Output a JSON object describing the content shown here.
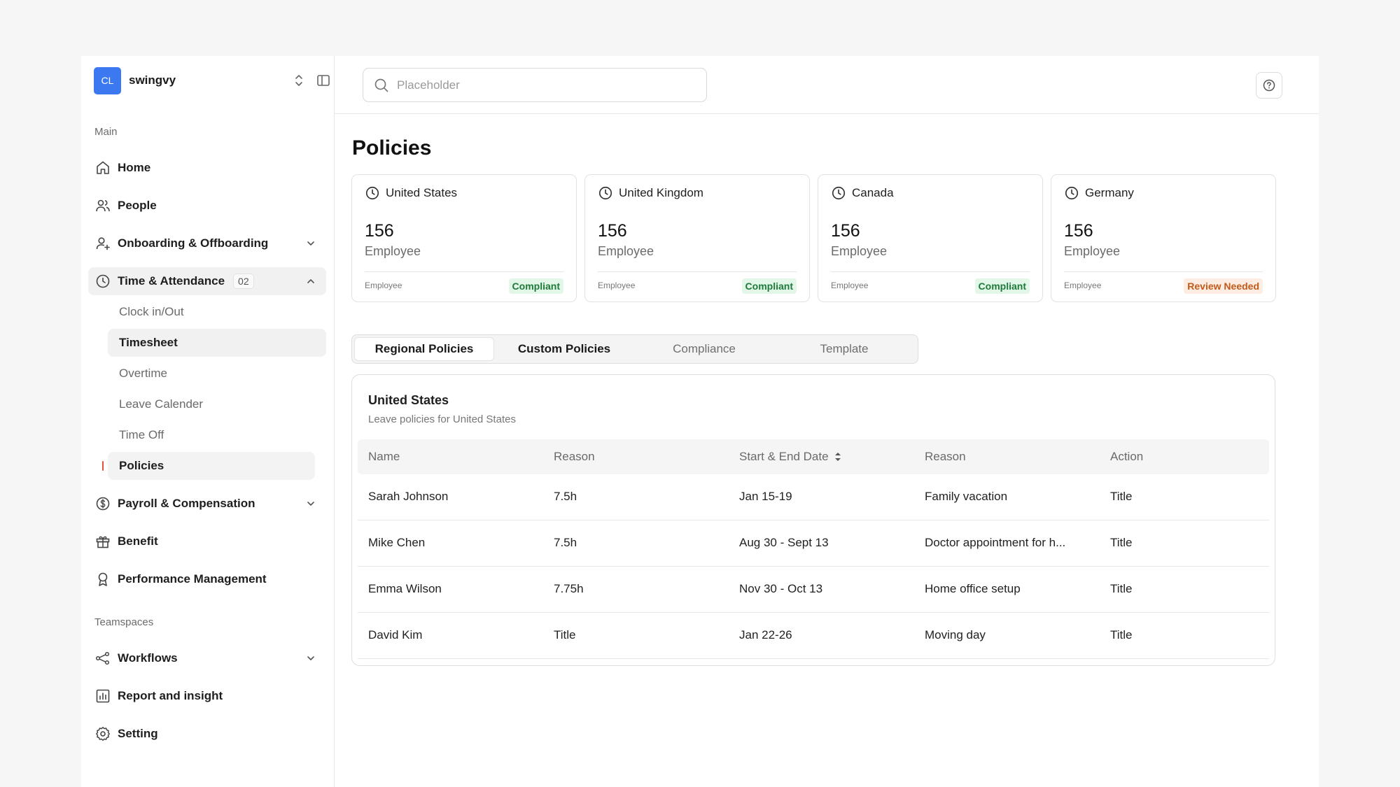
{
  "workspace": {
    "initials": "CL",
    "name": "swingvy"
  },
  "sidebar": {
    "main_label": "Main",
    "teamspaces_label": "Teamspaces",
    "items": [
      {
        "label": "Home",
        "icon": "home-icon"
      },
      {
        "label": "People",
        "icon": "people-icon"
      },
      {
        "label": "Onboarding & Offboarding",
        "icon": "user-plus-icon"
      },
      {
        "label": "Time & Attendance",
        "icon": "clock-icon",
        "badge": "02"
      },
      {
        "label": "Payroll & Compensation",
        "icon": "dollar-icon"
      },
      {
        "label": "Benefit",
        "icon": "gift-icon"
      },
      {
        "label": "Performance Management",
        "icon": "award-icon"
      }
    ],
    "sub_items": [
      {
        "label": "Clock in/Out"
      },
      {
        "label": "Timesheet"
      },
      {
        "label": "Overtime"
      },
      {
        "label": "Leave Calender"
      },
      {
        "label": "Time Off"
      },
      {
        "label": "Policies"
      }
    ],
    "team_items": [
      {
        "label": "Workflows",
        "icon": "workflow-icon"
      },
      {
        "label": "Report and insight",
        "icon": "chart-icon"
      },
      {
        "label": "Setting",
        "icon": "gear-icon"
      }
    ]
  },
  "search": {
    "placeholder": "Placeholder",
    "value": ""
  },
  "page": {
    "title": "Policies"
  },
  "cards": [
    {
      "country": "United States",
      "count": "156",
      "unit": "Employee",
      "foot": "Employee",
      "status": "Compliant",
      "status_color": "#1d7a3a"
    },
    {
      "country": "United Kingdom",
      "count": "156",
      "unit": "Employee",
      "foot": "Employee",
      "status": "Compliant",
      "status_color": "#1d7a3a"
    },
    {
      "country": "Canada",
      "count": "156",
      "unit": "Employee",
      "foot": "Employee",
      "status": "Compliant",
      "status_color": "#1d7a3a"
    },
    {
      "country": "Germany",
      "count": "156",
      "unit": "Employee",
      "foot": "Employee",
      "status": "Review Needed",
      "status_color": "#c25a1a"
    }
  ],
  "tabs": [
    {
      "label": "Regional Policies"
    },
    {
      "label": "Custom Policies"
    },
    {
      "label": "Compliance"
    },
    {
      "label": "Template"
    }
  ],
  "table": {
    "title": "United States",
    "subtitle": "Leave policies for United States",
    "headers": [
      "Name",
      "Reason",
      "Start & End Date",
      "Reason",
      "Action"
    ],
    "rows": [
      [
        "Sarah Johnson",
        "7.5h",
        "Jan 15-19",
        "Family vacation",
        "Title"
      ],
      [
        "Mike Chen",
        "7.5h",
        "Aug 30 - Sept 13",
        "Doctor appointment for h...",
        "Title"
      ],
      [
        "Emma Wilson",
        "7.75h",
        "Nov 30 - Oct 13",
        "Home office setup",
        "Title"
      ],
      [
        "David Kim",
        "Title",
        "Jan 22-26",
        "Moving day",
        "Title"
      ]
    ]
  },
  "colors": {
    "accent": "#3c79f0",
    "compliant_bg": "#e3f7e8",
    "review_bg": "#fdece1",
    "active_marker": "#e2533f"
  }
}
